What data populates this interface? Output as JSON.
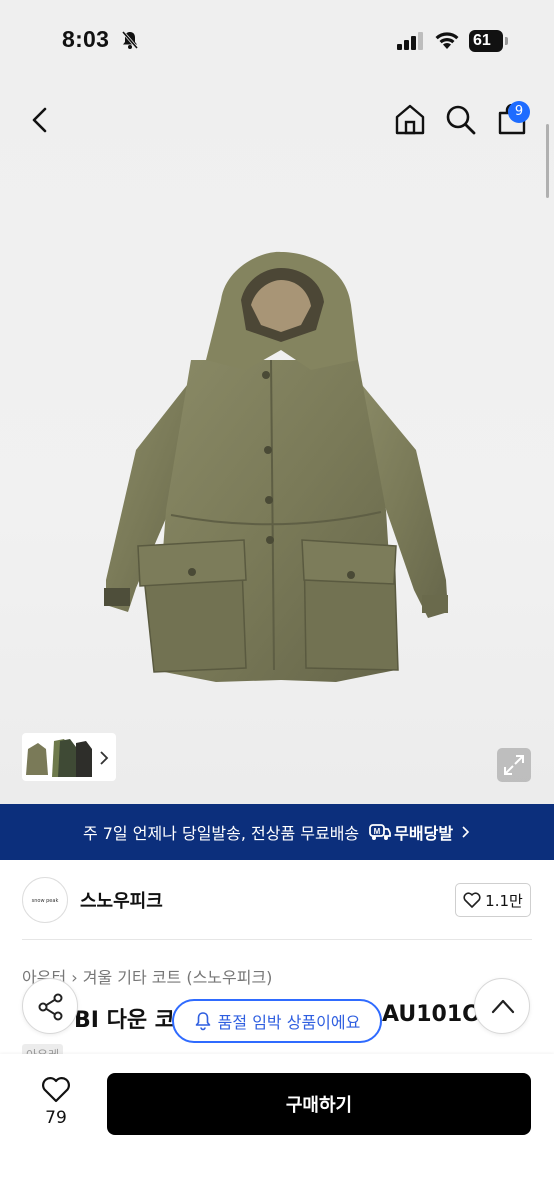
{
  "status_bar": {
    "time": "8:03",
    "battery": "61"
  },
  "header": {
    "cart_count": "9"
  },
  "shipping_banner": {
    "text": "주 7일 언제나 당일발송, 전상품 무료배송",
    "badge": "무배당발"
  },
  "shop": {
    "logo_text": "snow peak",
    "name": "스노우피크",
    "like_count": "1.1만"
  },
  "product": {
    "category_root": "아우터",
    "category_path": "겨울 기타 코트 (스노우피크)",
    "title_visible_start": "BI 다운 코",
    "title_visible_end": "AU101OL",
    "tag": "아우레"
  },
  "toast": {
    "text": "품절 임박 상품이에요"
  },
  "bottom_bar": {
    "wish_count": "79",
    "buy_label": "구매하기"
  },
  "colors": {
    "banner_bg": "#0c2f7c",
    "accent_blue": "#2f6bff",
    "badge_blue": "#1e6cff",
    "buy_button": "#000000",
    "coat_olive": "#7a7a58"
  }
}
